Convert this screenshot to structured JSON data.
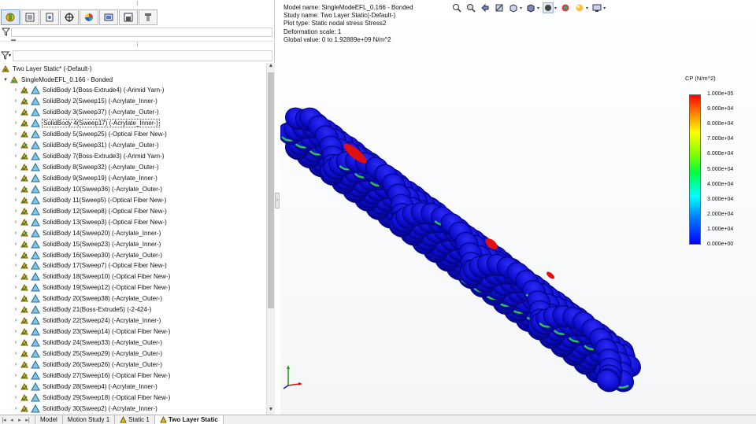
{
  "feature_manager": {
    "tabs": [
      {
        "icon": "simulation-study-icon"
      },
      {
        "icon": "property-manager-icon"
      },
      {
        "icon": "configuration-manager-icon"
      },
      {
        "icon": "dimxpert-icon"
      },
      {
        "icon": "appearance-icon"
      },
      {
        "icon": "camview-icon"
      },
      {
        "icon": "display-manager-icon"
      },
      {
        "icon": "simulation-tree-icon"
      }
    ],
    "root_label": "Two Layer Static* (-Default-)",
    "part_label": "SingleModeEFL_0.166 - Bonded",
    "bodies": [
      "SolidBody 1(Boss-Extrude4) (-Arimid Yarn-)",
      "SolidBody 2(Sweep15) (-Acrylate_Inner-)",
      "SolidBody 3(Sweep37) (-Acrylate_Outer-)",
      "SolidBody 4(Sweep17) (-Acrylate_Inner-)",
      "SolidBody 5(Sweep25) (-Optical Fiber New-)",
      "SolidBody 6(Sweep31) (-Acrylate_Outer-)",
      "SolidBody 7(Boss-Extrude3) (-Arimid Yarn-)",
      "SolidBody 8(Sweep32) (-Acrylate_Outer-)",
      "SolidBody 9(Sweep19) (-Acrylate_Inner-)",
      "SolidBody 10(Sweep36) (-Acrylate_Outer-)",
      "SolidBody 11(Sweep5) (-Optical Fiber New-)",
      "SolidBody 12(Sweep8) (-Optical Fiber New-)",
      "SolidBody 13(Sweep3) (-Optical Fiber New-)",
      "SolidBody 14(Sweep20) (-Acrylate_Inner-)",
      "SolidBody 15(Sweep23) (-Acrylate_Inner-)",
      "SolidBody 16(Sweep30) (-Acrylate_Outer-)",
      "SolidBody 17(Sweep7) (-Optical Fiber New-)",
      "SolidBody 18(Sweep10) (-Optical Fiber New-)",
      "SolidBody 19(Sweep12) (-Optical Fiber New-)",
      "SolidBody 20(Sweep38) (-Acrylate_Outer-)",
      "SolidBody 21(Boss-Extrude5) (-2-424-)",
      "SolidBody 22(Sweep24) (-Acrylate_Inner-)",
      "SolidBody 23(Sweep14) (-Optical Fiber New-)",
      "SolidBody 24(Sweep33) (-Acrylate_Outer-)",
      "SolidBody 25(Sweep29) (-Acrylate_Outer-)",
      "SolidBody 26(Sweep26) (-Acrylate_Outer-)",
      "SolidBody 27(Sweep16) (-Optical Fiber New-)",
      "SolidBody 28(Sweep4) (-Acrylate_Inner-)",
      "SolidBody 29(Sweep18) (-Optical Fiber New-)",
      "SolidBody 30(Sweep2) (-Acrylate_Inner-)"
    ],
    "selected_body_index": 3
  },
  "bottom_tabs": [
    {
      "label": "Model",
      "active": false
    },
    {
      "label": "Motion Study 1",
      "active": false
    },
    {
      "label": "Static 1",
      "active": false
    },
    {
      "label": "Two Layer Static",
      "active": true
    }
  ],
  "plot_info": {
    "line1": "Model name: SingleModeEFL_0.166 - Bonded",
    "line2": "Study name: Two Layer Static(-Default-)",
    "line3": "Plot type: Static nodal stress Stress2",
    "line4": "Deformation scale: 1",
    "line5": "Global value: 0 to 1.92889e+09 N/m^2"
  },
  "heads_up_toolbar": [
    "zoom-to-fit-icon",
    "zoom-to-area-icon",
    "previous-view-icon",
    "section-view-icon",
    "view-orientation-icon",
    "display-style-icon",
    "hide-show-items-icon",
    "edit-appearance-icon",
    "apply-scene-icon",
    "view-settings-icon"
  ],
  "legend": {
    "title": "CP (N/m^2)",
    "ticks": [
      "1.000e+05",
      "9.000e+04",
      "8.000e+04",
      "7.000e+04",
      "6.000e+04",
      "5.000e+04",
      "4.000e+04",
      "3.000e+04",
      "2.000e+04",
      "1.000e+04",
      "0.000e+00"
    ],
    "colors": [
      "#ff0000",
      "#ff8000",
      "#ffff00",
      "#80ff00",
      "#00ff40",
      "#00ffff",
      "#0080ff",
      "#0000ff"
    ]
  },
  "colors": {
    "model_blue": "#1010d8",
    "model_dark": "#05058a",
    "stress_green": "#2fc24a",
    "stress_red": "#e01010"
  }
}
